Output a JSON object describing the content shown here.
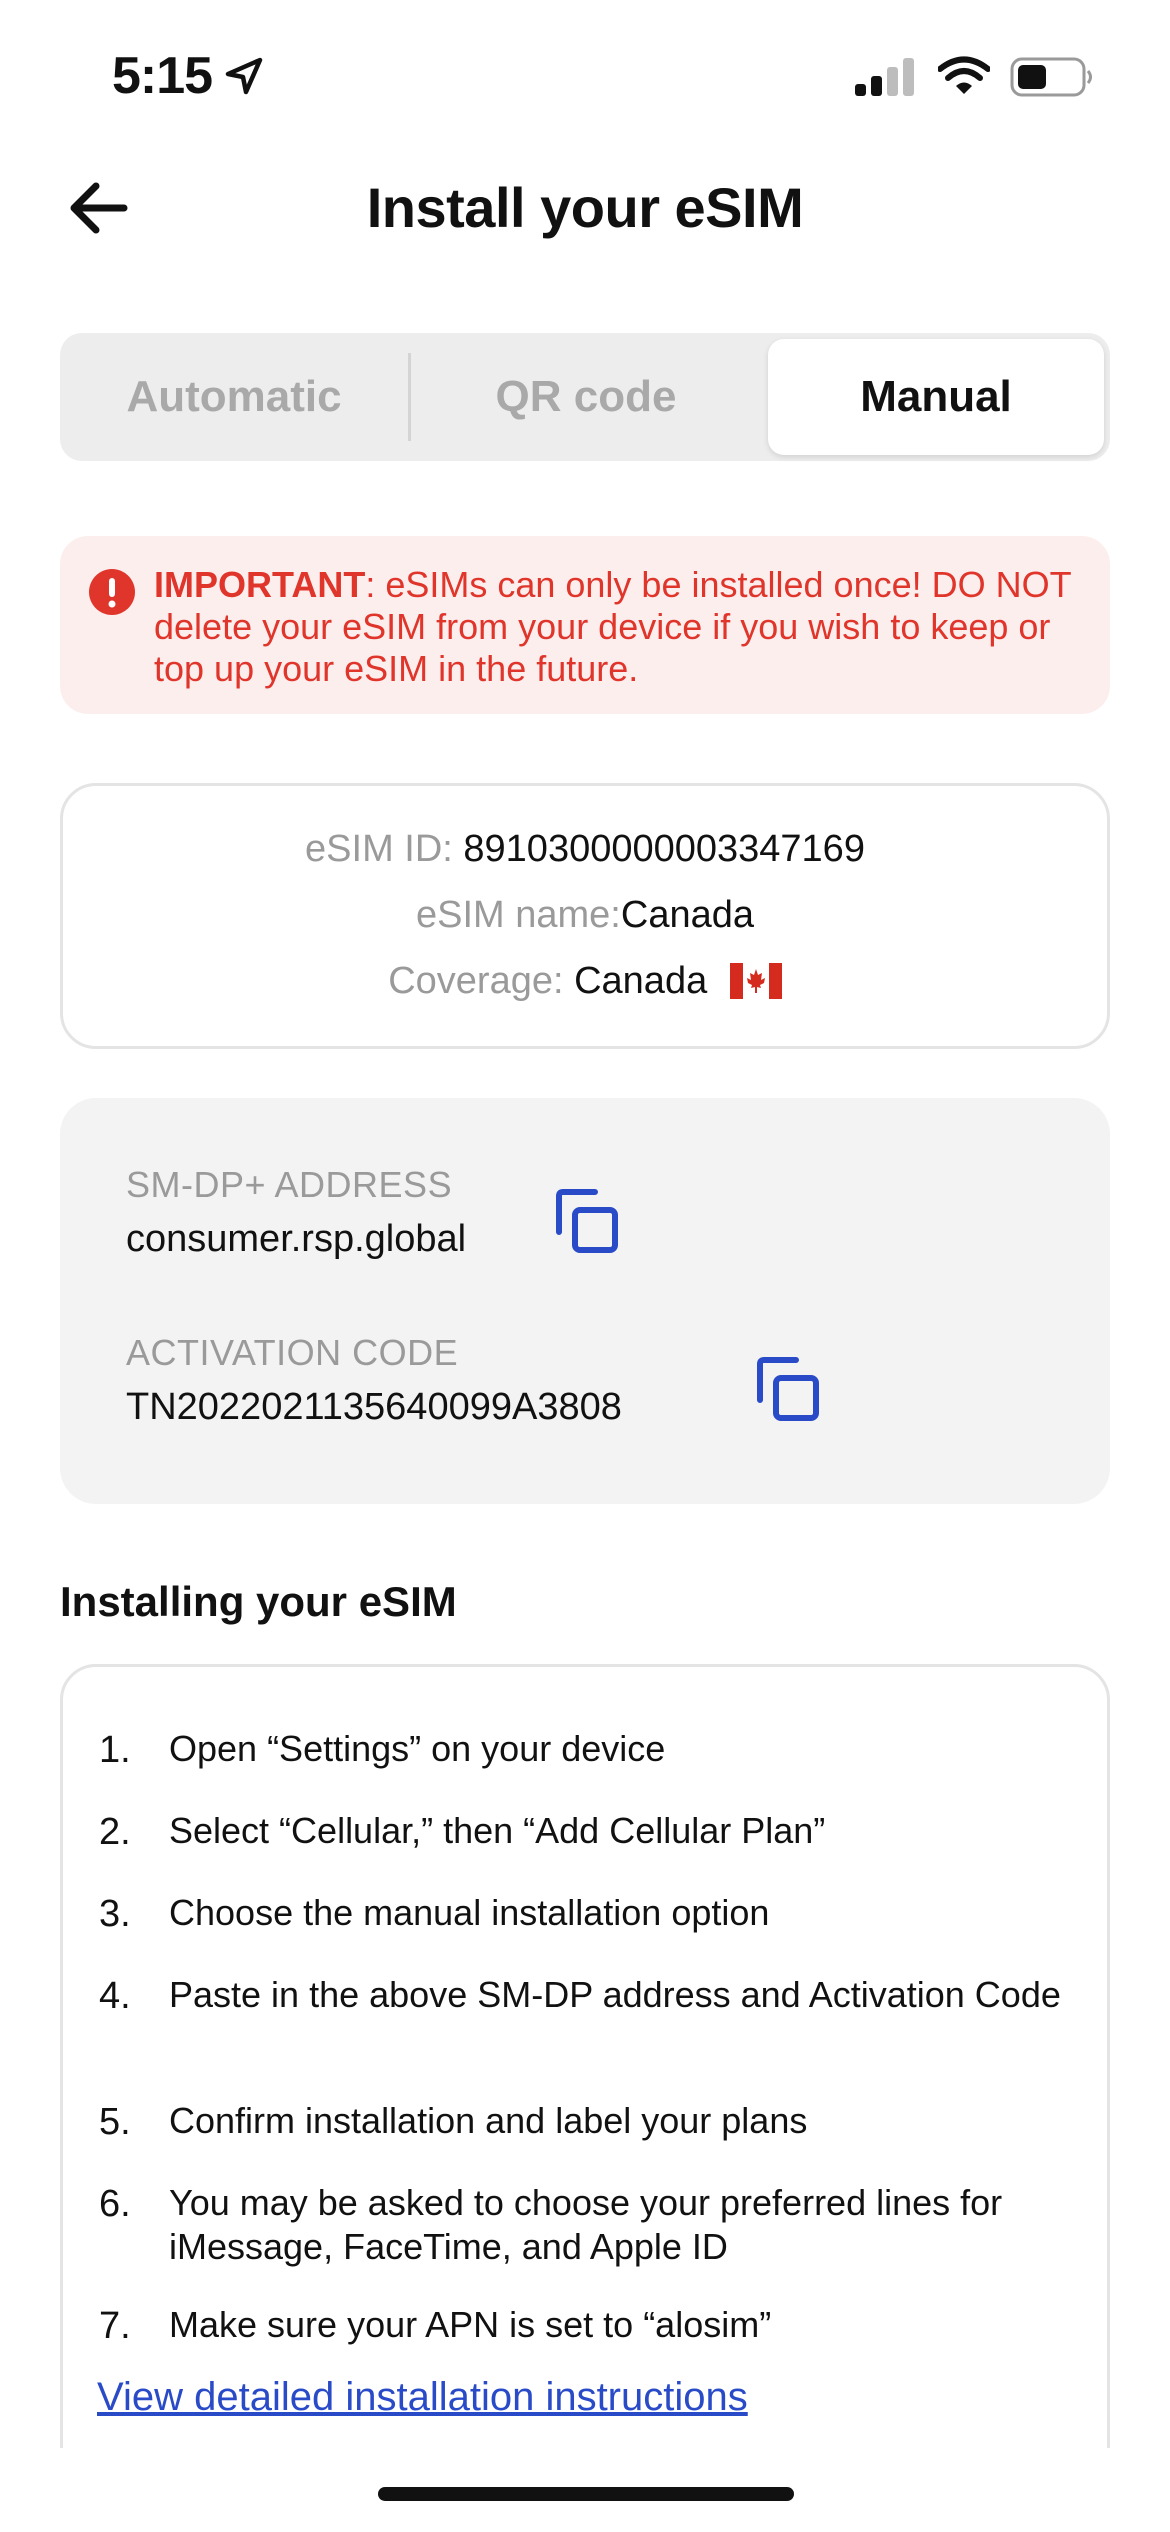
{
  "status_bar": {
    "time": "5:15"
  },
  "header": {
    "title": "Install your eSIM"
  },
  "tabs": [
    {
      "label": "Automatic",
      "selected": false
    },
    {
      "label": "QR code",
      "selected": false
    },
    {
      "label": "Manual",
      "selected": true
    }
  ],
  "warning": {
    "strong": "IMPORTANT",
    "text": ": eSIMs can only be installed once! DO NOT delete your eSIM from your device if you wish to keep or top up your eSIM in the future.",
    "color": "#e0352b",
    "background": "#fdeeee"
  },
  "esim_info": {
    "id_label": "eSIM ID:",
    "id_value": "8910300000003347169",
    "name_label": "eSIM name:",
    "name_value": "Canada",
    "coverage_label": "Coverage:",
    "coverage_value": "Canada",
    "coverage_flag": "canada-flag-icon"
  },
  "codes": {
    "smdp_label": "SM-DP+ ADDRESS",
    "smdp_value": "consumer.rsp.global",
    "activation_label": "ACTIVATION CODE",
    "activation_value": "TN2022021135640099A3808",
    "copy_icon": "copy-icon",
    "accent": "#2a4bc8"
  },
  "instructions": {
    "title": "Installing your eSIM",
    "steps": [
      {
        "num": "1.",
        "text": "Open “Settings” on your device"
      },
      {
        "num": "2.",
        "text": "Select “Cellular,” then “Add Cellular Plan”"
      },
      {
        "num": "3.",
        "text": "Choose the manual installation option"
      },
      {
        "num": "4.",
        "text": "Paste in the above SM-DP address and Activation Code"
      },
      {
        "num": "5.",
        "text": "Confirm installation and label your plans"
      },
      {
        "num": "6.",
        "text": "You may be asked to choose your preferred lines for iMessage, FaceTime, and Apple ID"
      },
      {
        "num": "7.",
        "text": "Make sure your APN is set to “alosim”"
      }
    ],
    "link": "View detailed installation instructions"
  }
}
